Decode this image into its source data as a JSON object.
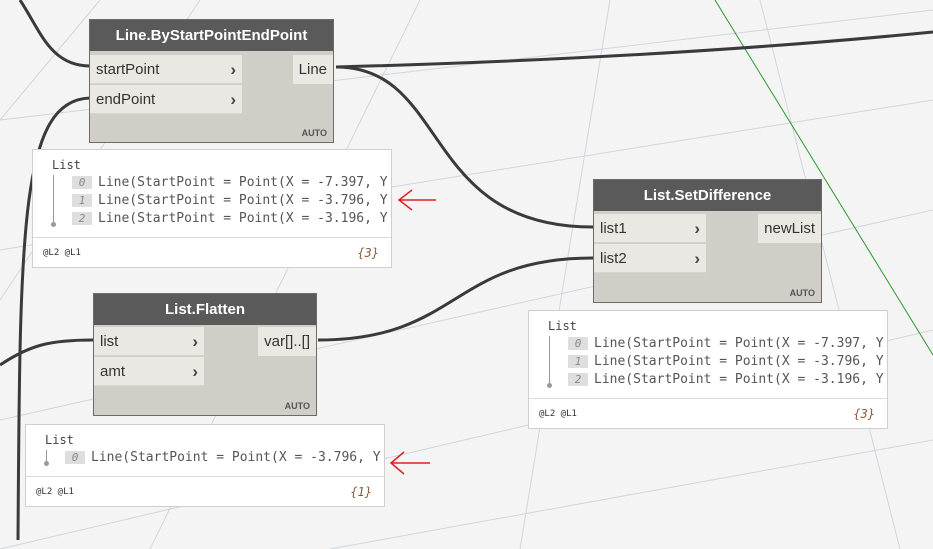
{
  "nodes": {
    "line_by_points": {
      "title": "Line.ByStartPointEndPoint",
      "inputs": [
        "startPoint",
        "endPoint"
      ],
      "output": "Line",
      "lacing": "AUTO",
      "preview": {
        "title": "List",
        "items": [
          {
            "index": "0",
            "value": "Line(StartPoint = Point(X = -7.397, Y"
          },
          {
            "index": "1",
            "value": "Line(StartPoint = Point(X = -3.796, Y"
          },
          {
            "index": "2",
            "value": "Line(StartPoint = Point(X = -3.196, Y"
          }
        ],
        "levels": "@L2 @L1",
        "count": "{3}"
      }
    },
    "set_difference": {
      "title": "List.SetDifference",
      "inputs": [
        "list1",
        "list2"
      ],
      "output": "newList",
      "lacing": "AUTO",
      "preview": {
        "title": "List",
        "items": [
          {
            "index": "0",
            "value": "Line(StartPoint = Point(X = -7.397, Y"
          },
          {
            "index": "1",
            "value": "Line(StartPoint = Point(X = -3.796, Y"
          },
          {
            "index": "2",
            "value": "Line(StartPoint = Point(X = -3.196, Y"
          }
        ],
        "levels": "@L2 @L1",
        "count": "{3}"
      }
    },
    "flatten": {
      "title": "List.Flatten",
      "inputs": [
        "list",
        "amt"
      ],
      "output": "var[]..[]",
      "lacing": "AUTO",
      "preview": {
        "title": "List",
        "items": [
          {
            "index": "0",
            "value": "Line(StartPoint = Point(X = -3.796, Y"
          }
        ],
        "levels": "@L2 @L1",
        "count": "{1}"
      }
    }
  },
  "icons": {
    "port_chevron": "chevron-right-icon",
    "annotation_arrow": "red-arrow-left-icon"
  },
  "colors": {
    "node_header": "#5a5a5a",
    "node_body": "#d1cdc7",
    "wire": "#3a3a3a",
    "annotation": "#e02020",
    "axis_green": "#2a9a2a"
  }
}
